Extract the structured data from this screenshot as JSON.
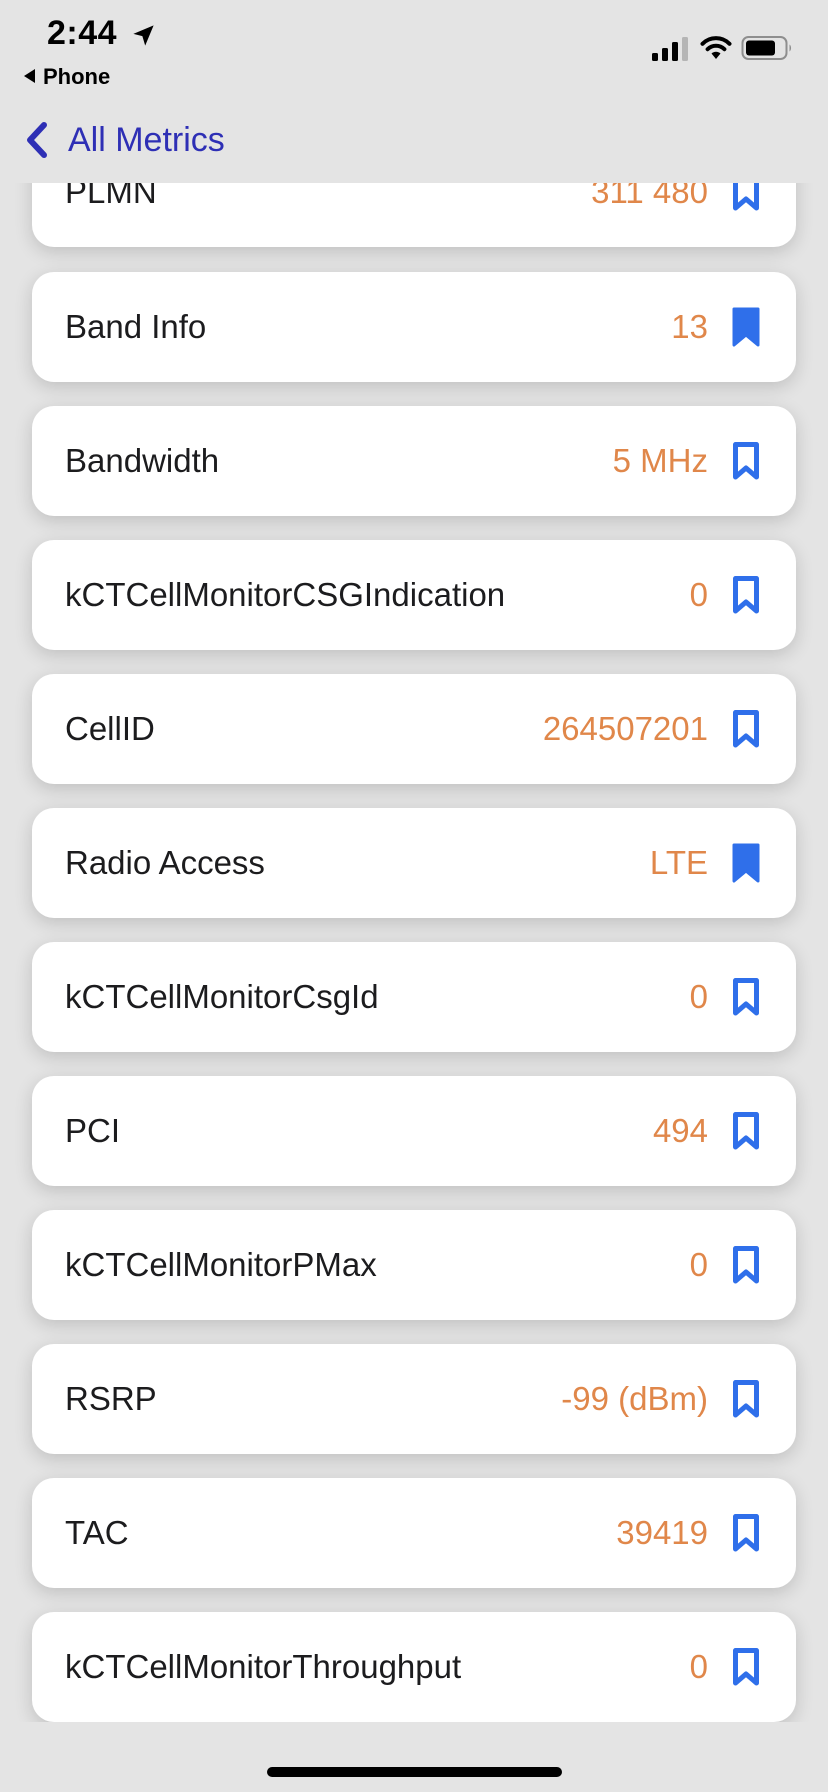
{
  "status_bar": {
    "time": "2:44",
    "back_app_label": "Phone"
  },
  "nav": {
    "back_label": "All Metrics"
  },
  "colors": {
    "value_orange": "#e0874a",
    "bookmark_blue": "#2f6fea",
    "nav_purple": "#2e2fb5"
  },
  "metrics": [
    {
      "label": "PLMN",
      "value": "311 480",
      "bookmarked": false
    },
    {
      "label": "Band Info",
      "value": "13",
      "bookmarked": true
    },
    {
      "label": "Bandwidth",
      "value": "5 MHz",
      "bookmarked": false
    },
    {
      "label": "kCTCellMonitorCSGIndication",
      "value": "0",
      "bookmarked": false
    },
    {
      "label": "CellID",
      "value": "264507201",
      "bookmarked": false
    },
    {
      "label": "Radio Access",
      "value": "LTE",
      "bookmarked": true
    },
    {
      "label": "kCTCellMonitorCsgId",
      "value": "0",
      "bookmarked": false
    },
    {
      "label": "PCI",
      "value": "494",
      "bookmarked": false
    },
    {
      "label": "kCTCellMonitorPMax",
      "value": "0",
      "bookmarked": false
    },
    {
      "label": "RSRP",
      "value": "-99 (dBm)",
      "bookmarked": false
    },
    {
      "label": "TAC",
      "value": "39419",
      "bookmarked": false
    },
    {
      "label": "kCTCellMonitorThroughput",
      "value": "0",
      "bookmarked": false
    }
  ]
}
